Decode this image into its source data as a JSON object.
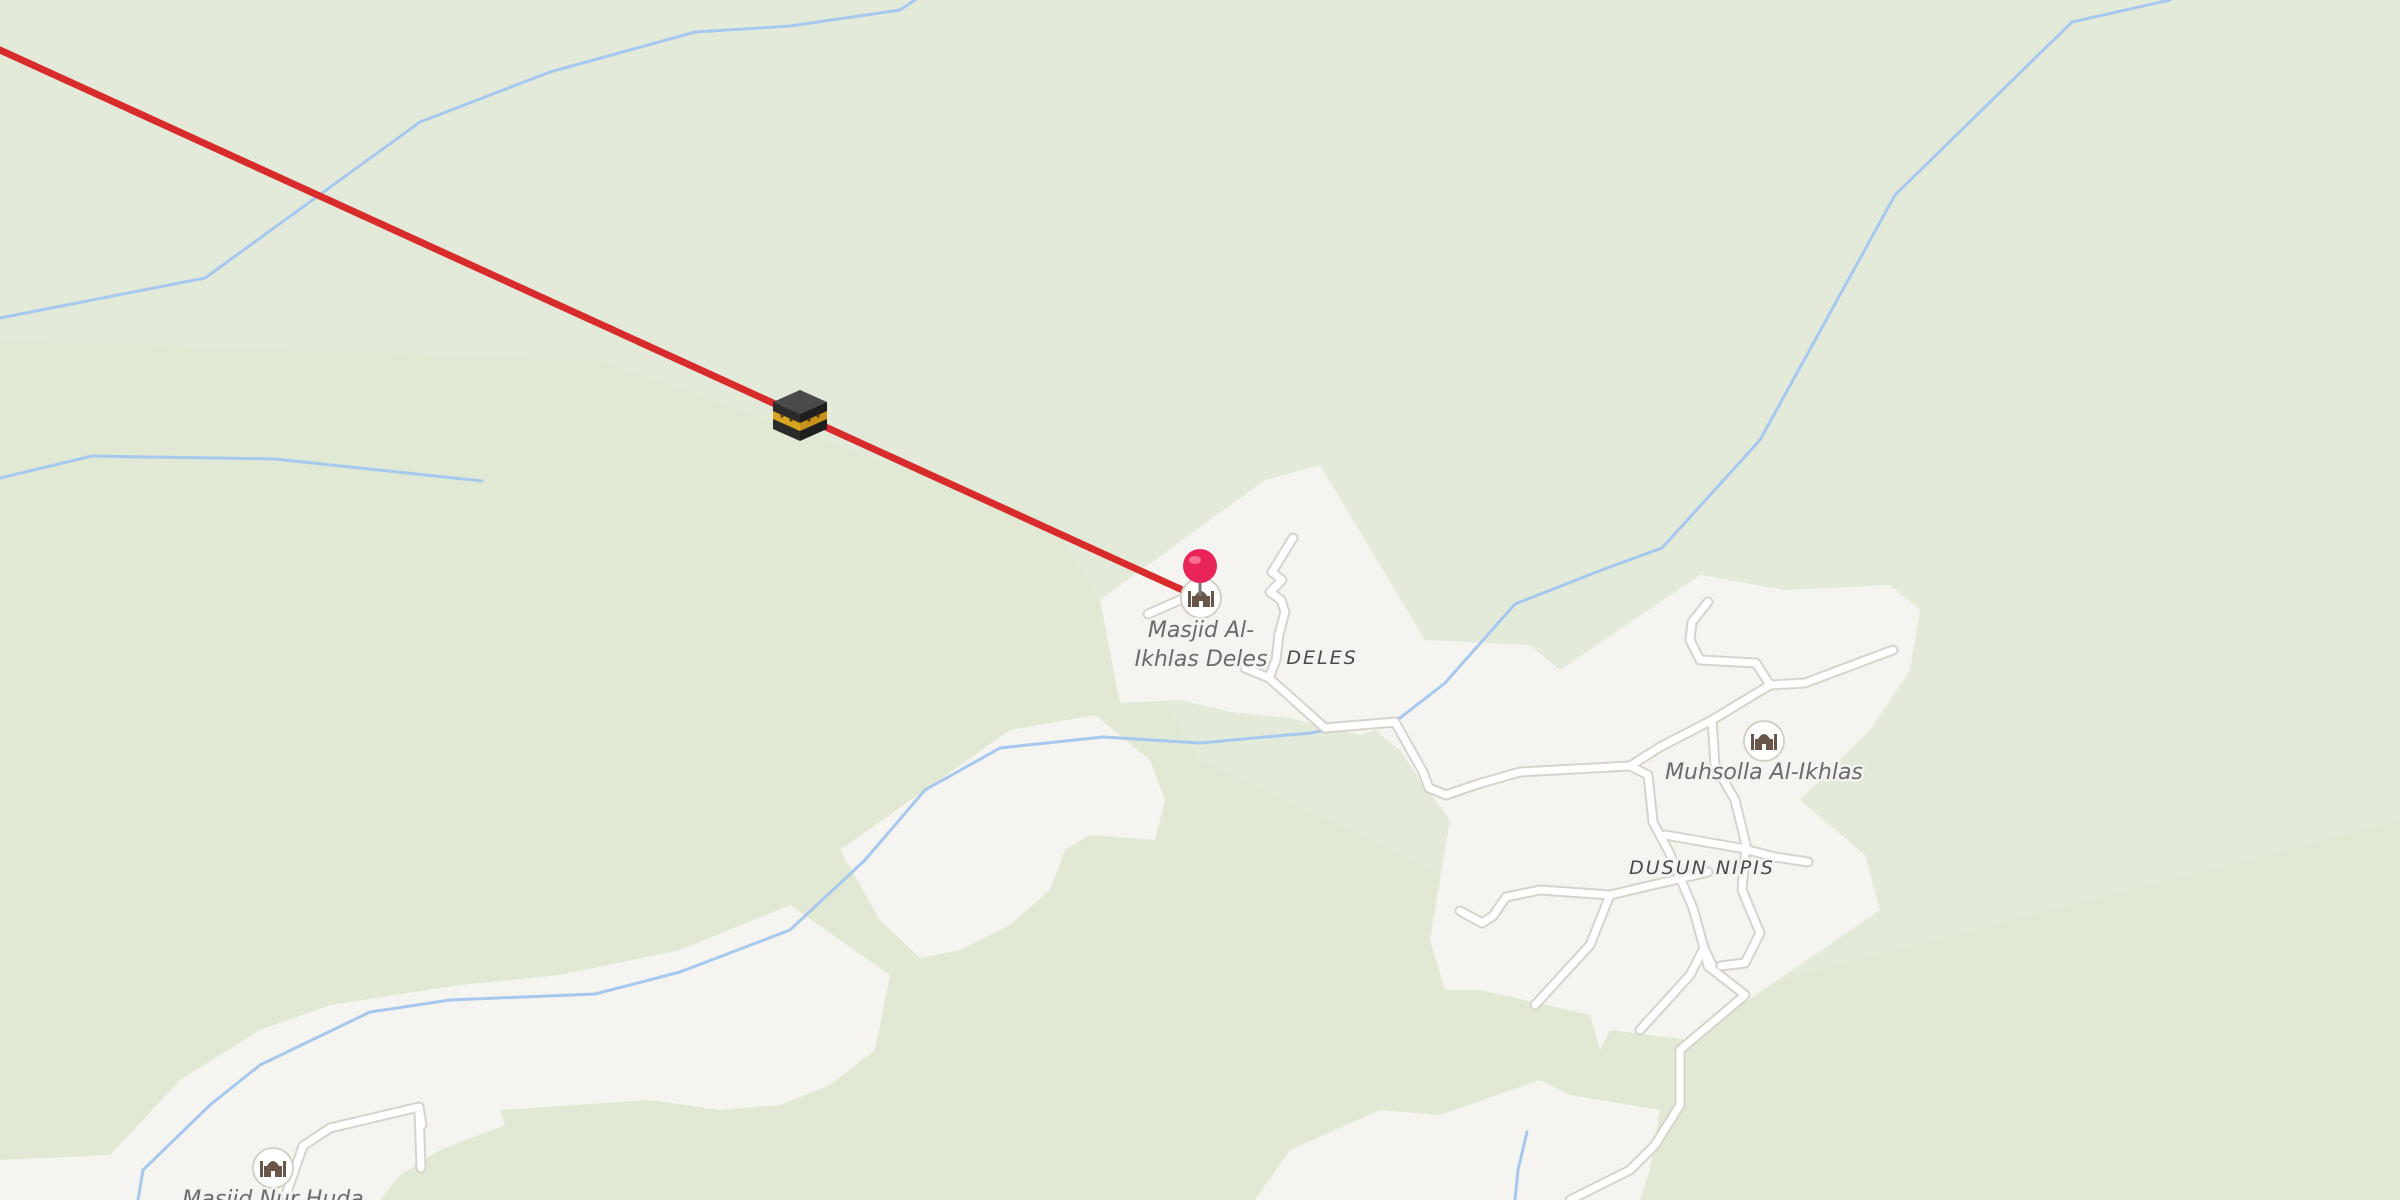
{
  "map": {
    "colors": {
      "land": "#e4ead9",
      "forest": "#dfe8d0",
      "settlement": "#f5f4f1",
      "water": "#a7c8ee",
      "road": "#ffffff",
      "road_casing": "#d9d6d0",
      "qibla_line": "#d82b2b",
      "pin": "#e8245a",
      "poi_icon": "#6a5549"
    },
    "places": [
      {
        "label": "DELES"
      },
      {
        "label": "DUSUN NIPIS"
      }
    ],
    "pois": [
      {
        "icon": "mosque-icon",
        "label_line1": "Masjid Al-",
        "label_line2": "Ikhlas Deles"
      },
      {
        "icon": "mosque-icon",
        "label_line1": "Muhsolla Al-Ikhlas",
        "label_line2": ""
      },
      {
        "icon": "mosque-icon",
        "label_line1": "Masjid Nur Huda",
        "label_line2": ""
      }
    ],
    "markers": [
      {
        "icon": "location-pin-icon"
      },
      {
        "icon": "kaaba-icon"
      }
    ],
    "overlays": [
      {
        "kind": "qibla-direction-line"
      }
    ]
  }
}
